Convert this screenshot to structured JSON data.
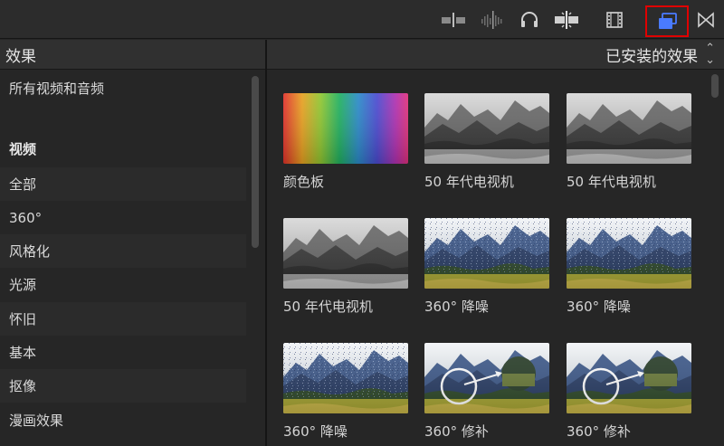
{
  "toolbar": {
    "buttons": [
      {
        "name": "audio-skimming-icon"
      },
      {
        "name": "audio-meter-icon"
      },
      {
        "name": "headphones-icon"
      },
      {
        "name": "snapping-icon"
      },
      {
        "name": "film-strip-icon"
      },
      {
        "name": "effects-browser-icon",
        "active": true
      },
      {
        "name": "transitions-browser-icon"
      }
    ],
    "active_highlight_color": "#e00000"
  },
  "left_panel": {
    "title": "效果"
  },
  "right_panel": {
    "sort_label": "已安装的效果"
  },
  "sidebar": {
    "items": [
      {
        "label": "所有视频和音频"
      },
      {
        "label": "视频"
      },
      {
        "label": "全部"
      },
      {
        "label": "360°"
      },
      {
        "label": "风格化"
      },
      {
        "label": "光源"
      },
      {
        "label": "怀旧"
      },
      {
        "label": "基本"
      },
      {
        "label": "抠像"
      },
      {
        "label": "漫画效果"
      }
    ]
  },
  "effects": [
    {
      "label": "颜色板",
      "thumb": "color-board"
    },
    {
      "label": "50 年代电视机",
      "thumb": "bw-landscape"
    },
    {
      "label": "50 年代电视机",
      "thumb": "bw-landscape"
    },
    {
      "label": "50 年代电视机",
      "thumb": "bw-landscape"
    },
    {
      "label": "360° 降噪",
      "thumb": "noisy-landscape"
    },
    {
      "label": "360° 降噪",
      "thumb": "noisy-landscape"
    },
    {
      "label": "360° 降噪",
      "thumb": "noisy-landscape"
    },
    {
      "label": "360° 修补",
      "thumb": "patch-landscape"
    },
    {
      "label": "360° 修补",
      "thumb": "patch-landscape"
    }
  ]
}
